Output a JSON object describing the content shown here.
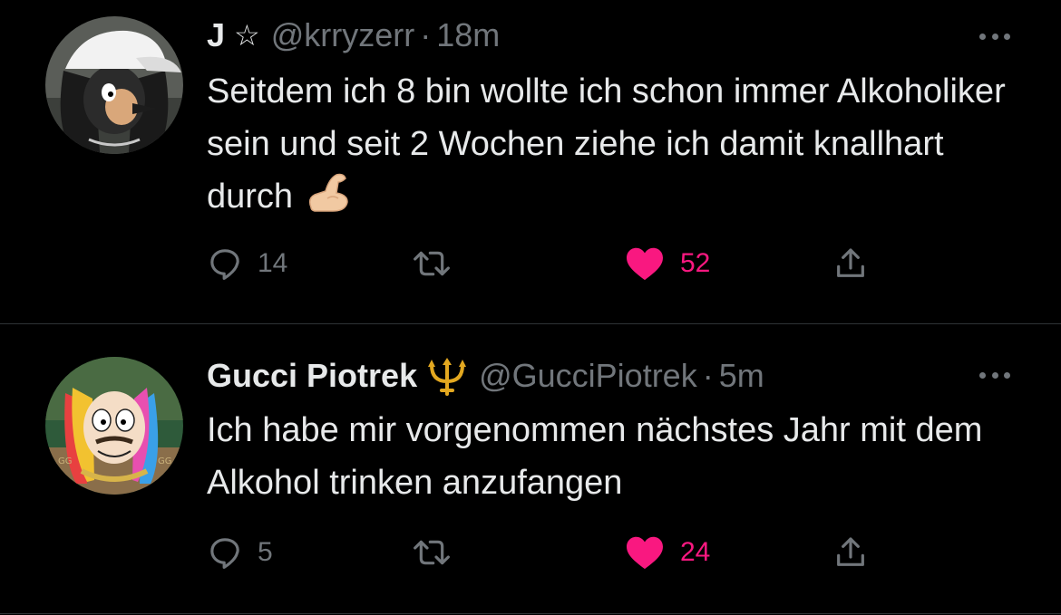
{
  "colors": {
    "background": "#000000",
    "text_primary": "#e7e9ea",
    "text_secondary": "#71767b",
    "divider": "#2f3336",
    "like_active": "#f91880"
  },
  "tweets": [
    {
      "display_name": "J",
      "name_badge_icon": "star-outline-icon",
      "name_badge": "☆",
      "handle": "@krryzerr",
      "separator": "·",
      "time": "18m",
      "text": "Seitdem ich 8 bin wollte ich schon immer Alkoholiker sein und seit 2 Wochen ziehe ich damit knallhart durch",
      "text_emoji_icon": "flexed-biceps-icon",
      "replies": "14",
      "retweets": "",
      "likes": "52",
      "liked": true
    },
    {
      "display_name": "Gucci Piotrek",
      "name_badge_icon": "trident-icon",
      "name_badge": "",
      "handle": "@GucciPiotrek",
      "separator": "·",
      "time": "5m",
      "text": "Ich habe mir vorgenommen nächstes Jahr mit dem Alkohol trinken anzufangen",
      "replies": "5",
      "retweets": "",
      "likes": "24",
      "liked": true
    }
  ]
}
